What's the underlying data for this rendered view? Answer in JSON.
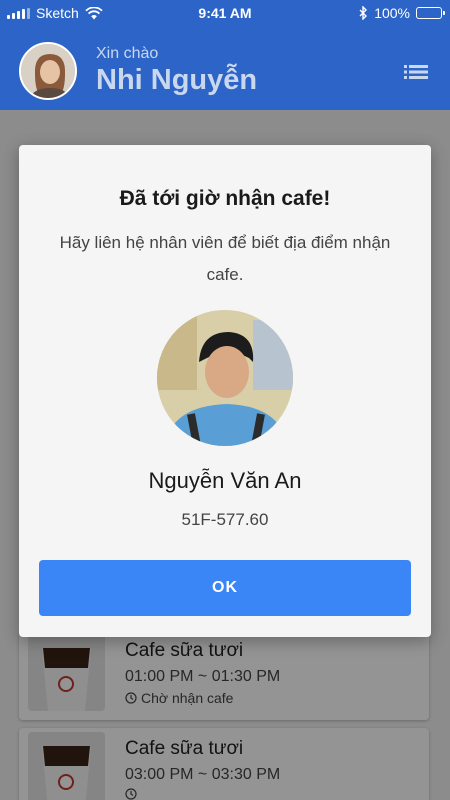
{
  "status_bar": {
    "carrier": "Sketch",
    "time": "9:41 AM",
    "battery": "100%"
  },
  "header": {
    "greeting": "Xin chào",
    "user_name": "Nhi Nguyễn"
  },
  "orders": [
    {
      "name": "Cafe sữa tươi",
      "time": "01:00 PM ~ 01:30 PM",
      "status": "Chờ nhận cafe"
    },
    {
      "name": "Cafe sữa tươi",
      "time": "03:00 PM ~ 03:30 PM",
      "status": ""
    }
  ],
  "modal": {
    "title": "Đã tới giờ nhận cafe!",
    "message": "Hãy liên hệ nhân viên để biết địa điểm nhận cafe.",
    "driver_name": "Nguyễn Văn An",
    "plate": "51F-577.60",
    "ok_label": "OK"
  },
  "colors": {
    "header": "#2c64c8",
    "button": "#3b86f7"
  }
}
